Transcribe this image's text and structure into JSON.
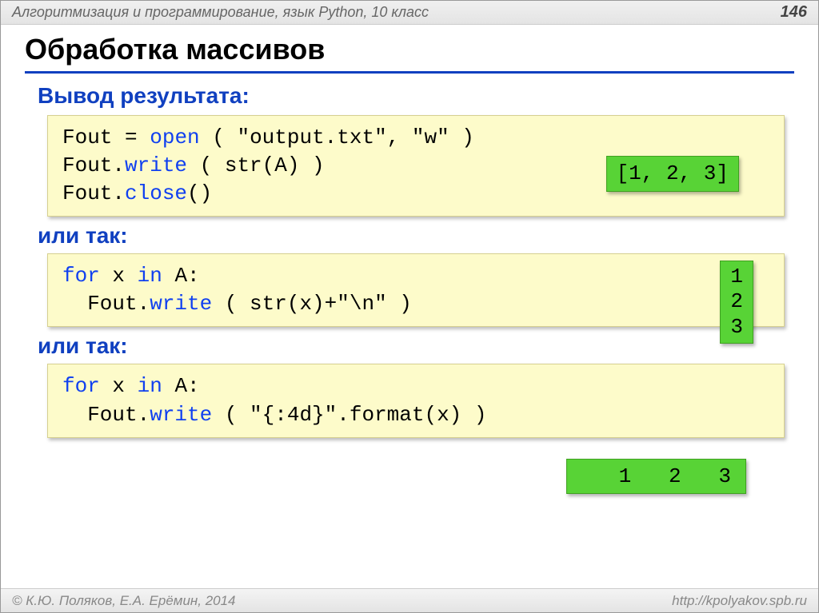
{
  "header": {
    "course": "Алгоритмизация и программирование, язык Python, 10 класс",
    "page": "146"
  },
  "title": "Обработка массивов",
  "section1": {
    "heading": "Вывод результата:",
    "code": {
      "l1a": "Fout",
      "l1b": " = ",
      "l1c": "open",
      "l1d": " ( \"output.txt\", \"w\" )",
      "l2a": "Fout.",
      "l2b": "write",
      "l2c": " ( str(A) )",
      "l3a": "Fout.",
      "l3b": "close",
      "l3c": "()"
    },
    "output": "[1, 2, 3]"
  },
  "section2": {
    "heading": "или так:",
    "code": {
      "l1a": "for",
      "l1b": " x ",
      "l1c": "in",
      "l1d": " A:",
      "l2a": "  Fout.",
      "l2b": "write",
      "l2c": " ( str(x)+\"\\n\" )"
    },
    "output": "1\n2\n3"
  },
  "section3": {
    "heading": "или так:",
    "code": {
      "l1a": "for",
      "l1b": " x ",
      "l1c": "in",
      "l1d": " A:",
      "l2a": "  Fout.",
      "l2b": "write",
      "l2c": " ( \"{:4d}\".format(x) )"
    },
    "output": "   1   2   3"
  },
  "footer": {
    "copyright": "© К.Ю. Поляков, Е.А. Ерёмин, 2014",
    "url": "http://kpolyakov.spb.ru"
  }
}
